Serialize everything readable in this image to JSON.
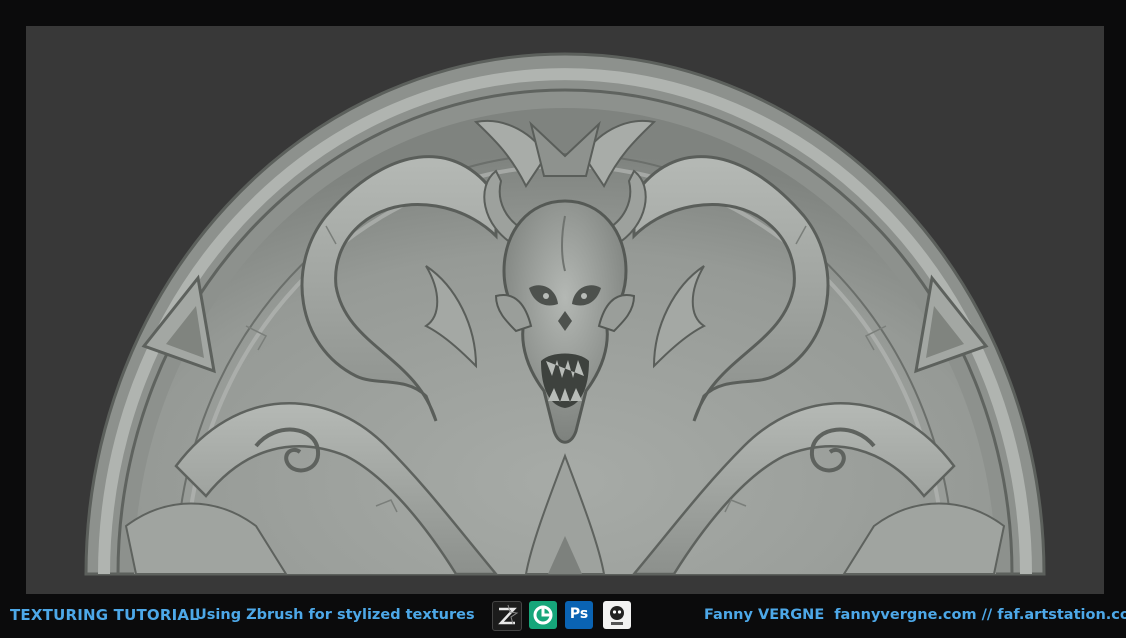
{
  "footer": {
    "title": "TEXTURING TUTORIAL",
    "subtitle": "Using Zbrush for stylized textures",
    "author": "Fanny VERGNE",
    "links": "fannyvergne.com // faf.artstation.com",
    "ps_label": "Ps"
  },
  "software_icons": [
    "zbrush-icon",
    "3ds-max-icon",
    "photoshop-icon",
    "substance-icon"
  ],
  "colors": {
    "accent": "#4da8e8",
    "stone": "#9a9e9a",
    "viewport_bg": "#383838",
    "frame_bg": "#0b0b0c"
  }
}
